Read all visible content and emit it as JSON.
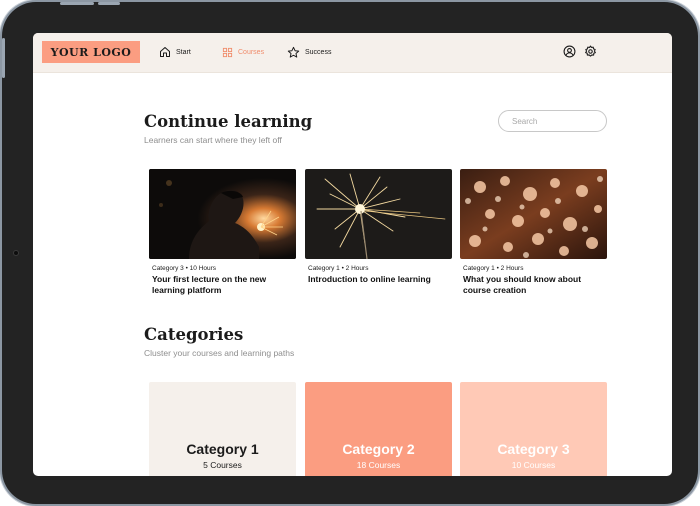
{
  "header": {
    "logo": "YOUR LOGO",
    "nav": [
      {
        "label": "Start",
        "icon": "home-icon"
      },
      {
        "label": "Courses",
        "icon": "grid-icon",
        "active": true
      },
      {
        "label": "Success",
        "icon": "star-icon"
      }
    ],
    "icons": [
      "user-circle-icon",
      "gear-icon"
    ]
  },
  "continue_learning": {
    "title": "Continue learning",
    "subtitle": "Learners can start where they left off",
    "search_placeholder": "Search",
    "courses": [
      {
        "meta": "Category 3 • 10 Hours",
        "title": "Your first lecture on the new learning platform"
      },
      {
        "meta": "Category 1 • 2 Hours",
        "title": "Introduction to online learning"
      },
      {
        "meta": "Category 1 • 2 Hours",
        "title": "What you should know about course creation"
      }
    ]
  },
  "categories": {
    "title": "Categories",
    "subtitle": "Cluster your courses and learning paths",
    "items": [
      {
        "name": "Category 1",
        "count": "5 Courses"
      },
      {
        "name": "Category 2",
        "count": "18 Courses"
      },
      {
        "name": "Category 3",
        "count": "10 Courses"
      }
    ]
  },
  "colors": {
    "accent": "#fb9d81",
    "accent_light": "#ffc9b6",
    "header_bg": "#f5f0eb",
    "active_nav": "#f08d6d",
    "device_frame": "#232323"
  }
}
